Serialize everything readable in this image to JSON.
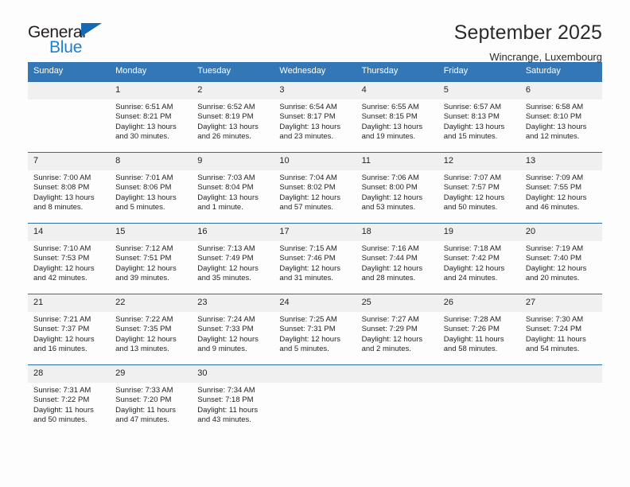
{
  "logo": {
    "line1": "General",
    "line2": "Blue",
    "triangle_color": "#1668b3",
    "blue_color": "#2080d0"
  },
  "header": {
    "title": "September 2025",
    "subtitle": "Wincrange, Luxembourg"
  },
  "theme": {
    "header_bg": "#3477b7",
    "week_border": "#2e6da4",
    "day_number_bg": "#f0f0f0"
  },
  "calendar": {
    "day_headers": [
      "Sunday",
      "Monday",
      "Tuesday",
      "Wednesday",
      "Thursday",
      "Friday",
      "Saturday"
    ],
    "weeks": [
      [
        {
          "day": "",
          "empty": true,
          "sunrise": "",
          "sunset": "",
          "daylight_line1": "",
          "daylight_line2": ""
        },
        {
          "day": "1",
          "sunrise": "Sunrise: 6:51 AM",
          "sunset": "Sunset: 8:21 PM",
          "daylight_line1": "Daylight: 13 hours",
          "daylight_line2": "and 30 minutes."
        },
        {
          "day": "2",
          "sunrise": "Sunrise: 6:52 AM",
          "sunset": "Sunset: 8:19 PM",
          "daylight_line1": "Daylight: 13 hours",
          "daylight_line2": "and 26 minutes."
        },
        {
          "day": "3",
          "sunrise": "Sunrise: 6:54 AM",
          "sunset": "Sunset: 8:17 PM",
          "daylight_line1": "Daylight: 13 hours",
          "daylight_line2": "and 23 minutes."
        },
        {
          "day": "4",
          "sunrise": "Sunrise: 6:55 AM",
          "sunset": "Sunset: 8:15 PM",
          "daylight_line1": "Daylight: 13 hours",
          "daylight_line2": "and 19 minutes."
        },
        {
          "day": "5",
          "sunrise": "Sunrise: 6:57 AM",
          "sunset": "Sunset: 8:13 PM",
          "daylight_line1": "Daylight: 13 hours",
          "daylight_line2": "and 15 minutes."
        },
        {
          "day": "6",
          "sunrise": "Sunrise: 6:58 AM",
          "sunset": "Sunset: 8:10 PM",
          "daylight_line1": "Daylight: 13 hours",
          "daylight_line2": "and 12 minutes."
        }
      ],
      [
        {
          "day": "7",
          "sunrise": "Sunrise: 7:00 AM",
          "sunset": "Sunset: 8:08 PM",
          "daylight_line1": "Daylight: 13 hours",
          "daylight_line2": "and 8 minutes."
        },
        {
          "day": "8",
          "sunrise": "Sunrise: 7:01 AM",
          "sunset": "Sunset: 8:06 PM",
          "daylight_line1": "Daylight: 13 hours",
          "daylight_line2": "and 5 minutes."
        },
        {
          "day": "9",
          "sunrise": "Sunrise: 7:03 AM",
          "sunset": "Sunset: 8:04 PM",
          "daylight_line1": "Daylight: 13 hours",
          "daylight_line2": "and 1 minute."
        },
        {
          "day": "10",
          "sunrise": "Sunrise: 7:04 AM",
          "sunset": "Sunset: 8:02 PM",
          "daylight_line1": "Daylight: 12 hours",
          "daylight_line2": "and 57 minutes."
        },
        {
          "day": "11",
          "sunrise": "Sunrise: 7:06 AM",
          "sunset": "Sunset: 8:00 PM",
          "daylight_line1": "Daylight: 12 hours",
          "daylight_line2": "and 53 minutes."
        },
        {
          "day": "12",
          "sunrise": "Sunrise: 7:07 AM",
          "sunset": "Sunset: 7:57 PM",
          "daylight_line1": "Daylight: 12 hours",
          "daylight_line2": "and 50 minutes."
        },
        {
          "day": "13",
          "sunrise": "Sunrise: 7:09 AM",
          "sunset": "Sunset: 7:55 PM",
          "daylight_line1": "Daylight: 12 hours",
          "daylight_line2": "and 46 minutes."
        }
      ],
      [
        {
          "day": "14",
          "sunrise": "Sunrise: 7:10 AM",
          "sunset": "Sunset: 7:53 PM",
          "daylight_line1": "Daylight: 12 hours",
          "daylight_line2": "and 42 minutes."
        },
        {
          "day": "15",
          "sunrise": "Sunrise: 7:12 AM",
          "sunset": "Sunset: 7:51 PM",
          "daylight_line1": "Daylight: 12 hours",
          "daylight_line2": "and 39 minutes."
        },
        {
          "day": "16",
          "sunrise": "Sunrise: 7:13 AM",
          "sunset": "Sunset: 7:49 PM",
          "daylight_line1": "Daylight: 12 hours",
          "daylight_line2": "and 35 minutes."
        },
        {
          "day": "17",
          "sunrise": "Sunrise: 7:15 AM",
          "sunset": "Sunset: 7:46 PM",
          "daylight_line1": "Daylight: 12 hours",
          "daylight_line2": "and 31 minutes."
        },
        {
          "day": "18",
          "sunrise": "Sunrise: 7:16 AM",
          "sunset": "Sunset: 7:44 PM",
          "daylight_line1": "Daylight: 12 hours",
          "daylight_line2": "and 28 minutes."
        },
        {
          "day": "19",
          "sunrise": "Sunrise: 7:18 AM",
          "sunset": "Sunset: 7:42 PM",
          "daylight_line1": "Daylight: 12 hours",
          "daylight_line2": "and 24 minutes."
        },
        {
          "day": "20",
          "sunrise": "Sunrise: 7:19 AM",
          "sunset": "Sunset: 7:40 PM",
          "daylight_line1": "Daylight: 12 hours",
          "daylight_line2": "and 20 minutes."
        }
      ],
      [
        {
          "day": "21",
          "sunrise": "Sunrise: 7:21 AM",
          "sunset": "Sunset: 7:37 PM",
          "daylight_line1": "Daylight: 12 hours",
          "daylight_line2": "and 16 minutes."
        },
        {
          "day": "22",
          "sunrise": "Sunrise: 7:22 AM",
          "sunset": "Sunset: 7:35 PM",
          "daylight_line1": "Daylight: 12 hours",
          "daylight_line2": "and 13 minutes."
        },
        {
          "day": "23",
          "sunrise": "Sunrise: 7:24 AM",
          "sunset": "Sunset: 7:33 PM",
          "daylight_line1": "Daylight: 12 hours",
          "daylight_line2": "and 9 minutes."
        },
        {
          "day": "24",
          "sunrise": "Sunrise: 7:25 AM",
          "sunset": "Sunset: 7:31 PM",
          "daylight_line1": "Daylight: 12 hours",
          "daylight_line2": "and 5 minutes."
        },
        {
          "day": "25",
          "sunrise": "Sunrise: 7:27 AM",
          "sunset": "Sunset: 7:29 PM",
          "daylight_line1": "Daylight: 12 hours",
          "daylight_line2": "and 2 minutes."
        },
        {
          "day": "26",
          "sunrise": "Sunrise: 7:28 AM",
          "sunset": "Sunset: 7:26 PM",
          "daylight_line1": "Daylight: 11 hours",
          "daylight_line2": "and 58 minutes."
        },
        {
          "day": "27",
          "sunrise": "Sunrise: 7:30 AM",
          "sunset": "Sunset: 7:24 PM",
          "daylight_line1": "Daylight: 11 hours",
          "daylight_line2": "and 54 minutes."
        }
      ],
      [
        {
          "day": "28",
          "sunrise": "Sunrise: 7:31 AM",
          "sunset": "Sunset: 7:22 PM",
          "daylight_line1": "Daylight: 11 hours",
          "daylight_line2": "and 50 minutes."
        },
        {
          "day": "29",
          "sunrise": "Sunrise: 7:33 AM",
          "sunset": "Sunset: 7:20 PM",
          "daylight_line1": "Daylight: 11 hours",
          "daylight_line2": "and 47 minutes."
        },
        {
          "day": "30",
          "sunrise": "Sunrise: 7:34 AM",
          "sunset": "Sunset: 7:18 PM",
          "daylight_line1": "Daylight: 11 hours",
          "daylight_line2": "and 43 minutes."
        },
        {
          "day": "",
          "empty": true,
          "sunrise": "",
          "sunset": "",
          "daylight_line1": "",
          "daylight_line2": ""
        },
        {
          "day": "",
          "empty": true,
          "sunrise": "",
          "sunset": "",
          "daylight_line1": "",
          "daylight_line2": ""
        },
        {
          "day": "",
          "empty": true,
          "sunrise": "",
          "sunset": "",
          "daylight_line1": "",
          "daylight_line2": ""
        },
        {
          "day": "",
          "empty": true,
          "sunrise": "",
          "sunset": "",
          "daylight_line1": "",
          "daylight_line2": ""
        }
      ]
    ]
  }
}
